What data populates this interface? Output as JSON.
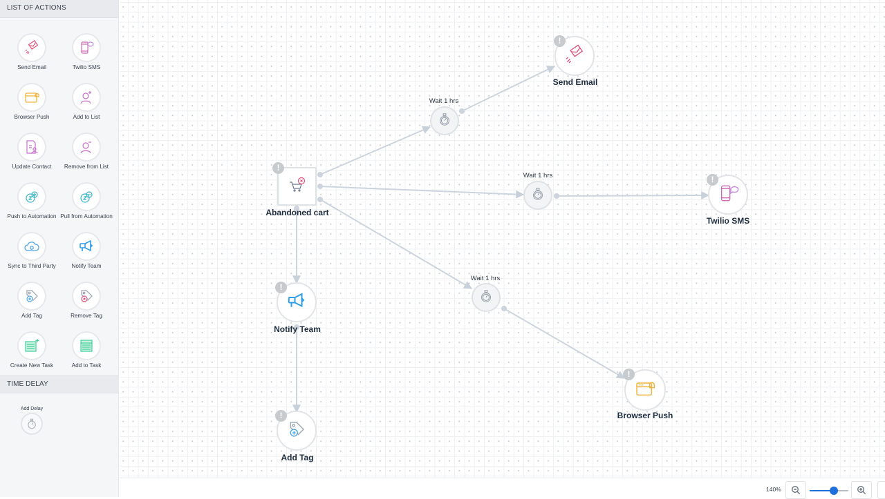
{
  "sidebar": {
    "actions_header": "LIST OF ACTIONS",
    "actions": [
      {
        "label": "Send Email",
        "icon": "send-email-icon"
      },
      {
        "label": "Twilio SMS",
        "icon": "sms-phone-icon"
      },
      {
        "label": "Browser Push",
        "icon": "browser-push-icon"
      },
      {
        "label": "Add to List",
        "icon": "add-user-icon"
      },
      {
        "label": "Update Contact",
        "icon": "update-contact-icon"
      },
      {
        "label": "Remove from List",
        "icon": "remove-user-icon"
      },
      {
        "label": "Push to Automation",
        "icon": "push-automation-icon"
      },
      {
        "label": "Pull from Automation",
        "icon": "pull-automation-icon"
      },
      {
        "label": "Sync to Third Party",
        "icon": "cloud-sync-icon"
      },
      {
        "label": "Notify Team",
        "icon": "megaphone-icon"
      },
      {
        "label": "Add Tag",
        "icon": "add-tag-icon"
      },
      {
        "label": "Remove Tag",
        "icon": "remove-tag-icon"
      },
      {
        "label": "Create New Task",
        "icon": "create-task-icon"
      },
      {
        "label": "Add to Task",
        "icon": "add-task-icon"
      }
    ],
    "delay_header": "TIME DELAY",
    "delay_item": {
      "label": "Add Delay",
      "icon": "stopwatch-icon"
    }
  },
  "canvas": {
    "nodes": [
      {
        "id": "abandoned-cart",
        "title": "Abandoned cart",
        "icon": "cart-remove-icon",
        "warning": "!"
      },
      {
        "id": "send-email",
        "title": "Send Email",
        "icon": "send-email-icon",
        "warning": "!"
      },
      {
        "id": "twilio-sms",
        "title": "Twilio SMS",
        "icon": "sms-phone-icon",
        "warning": "!"
      },
      {
        "id": "notify-team",
        "title": "Notify Team",
        "icon": "megaphone-icon",
        "warning": "!"
      },
      {
        "id": "add-tag",
        "title": "Add Tag",
        "icon": "add-tag-icon",
        "warning": "!"
      },
      {
        "id": "browser-push",
        "title": "Browser Push",
        "icon": "browser-push-icon",
        "warning": "!"
      }
    ],
    "waits": [
      {
        "label": "Wait  1 hrs"
      },
      {
        "label": "Wait  1 hrs"
      },
      {
        "label": "Wait  1 hrs"
      }
    ]
  },
  "footer": {
    "zoom_level": "140%",
    "zoom_slider_fraction": 0.62
  },
  "colors": {
    "accent": "#1e6fd9",
    "email_pink": "#e0507a",
    "sms_purple": "#c86fd0",
    "push_yellow": "#f0b43c",
    "notify_blue": "#2e9ee6",
    "task_green": "#3fcf9b"
  }
}
